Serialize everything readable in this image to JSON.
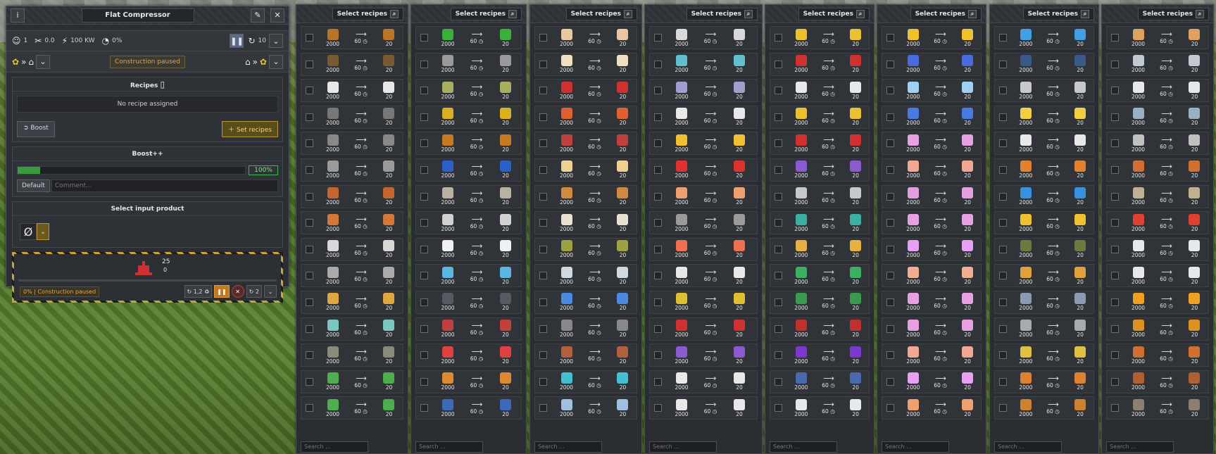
{
  "window": {
    "title": "Flat Compressor"
  },
  "stats": {
    "workers": "1",
    "maintenance": "0.0",
    "power": "100 KW",
    "computing": "0%"
  },
  "control": {
    "pause_count": "10",
    "construction_status": "Construction paused"
  },
  "recipes_section": {
    "heading": "Recipes",
    "empty_text": "No recipe assigned",
    "boost_label": "Boost",
    "set_recipes_label": "Set recipes"
  },
  "boost_section": {
    "heading": "Boost++",
    "percent": "100%",
    "fill_fraction": 0.1,
    "default_label": "Default",
    "comment_placeholder": "Comment..."
  },
  "input_section": {
    "heading": "Select input product",
    "empty_symbol": "Ø"
  },
  "construction": {
    "count_top": "25",
    "count_bottom": "0",
    "status": "0% | Construction paused",
    "priority": "1,2",
    "level": "2"
  },
  "recipe_picker": {
    "header_label": "Select recipes",
    "search_placeholder": "Search ...",
    "input_qty": "2000",
    "duration": "60",
    "output_qty": "20"
  },
  "columns": [
    {
      "colors": [
        "#b9742a",
        "#7a5a30",
        "#e8e8e8",
        "#777777",
        "#888888",
        "#9a9a9a",
        "#c4642e",
        "#d4783a",
        "#d8d8d8",
        "#aaaaaa",
        "#e0a640",
        "#7ac8c0",
        "#8a8a7a",
        "#4cae4c",
        "#4cae4c"
      ]
    },
    {
      "colors": [
        "#3cae3c",
        "#9a9a9a",
        "#a8b060",
        "#d8b020",
        "#c87a20",
        "#2a60c8",
        "#b8b0a0",
        "#d0d0d0",
        "#f0f0f0",
        "#5ab8e0",
        "#555a60",
        "#c04040",
        "#e04040",
        "#e08a30",
        "#3a6ab8"
      ]
    },
    {
      "colors": [
        "#e8c8a0",
        "#f0e0c0",
        "#d03030",
        "#e06030",
        "#c04040",
        "#f0d090",
        "#d08a40",
        "#e8e0d0",
        "#a0a040",
        "#d0d8e0",
        "#4a8ae0",
        "#888888",
        "#b0603a",
        "#40c0d0",
        "#a0c0e0"
      ]
    },
    {
      "colors": [
        "#d8d8d8",
        "#60c0d0",
        "#a0a0d0",
        "#e8e8e8",
        "#f0c030",
        "#e03030",
        "#f0a070",
        "#9a9a9a",
        "#f07050",
        "#e8e8e8",
        "#e0c030",
        "#d03030",
        "#8a5ad0",
        "#e8e8e8",
        "#e8e8e8"
      ]
    },
    {
      "colors": [
        "#e8c030",
        "#d03030",
        "#e8e8e8",
        "#e8c030",
        "#d03030",
        "#8a5ad0",
        "#c8c8c8",
        "#3ab0a0",
        "#e8b040",
        "#3ab060",
        "#3a9a50",
        "#c03030",
        "#7a3ad0",
        "#4a6ab0",
        "#e8e8e8"
      ]
    },
    {
      "colors": [
        "#f0c030",
        "#4a6ae0",
        "#a0d0f0",
        "#4a7ae0",
        "#e8a0e0",
        "#f0a890",
        "#e0a0e0",
        "#e8a0e0",
        "#e8a0f0",
        "#f0b090",
        "#e8a0e0",
        "#e8a0e0",
        "#f0a890",
        "#e8a0f0",
        "#f0a070"
      ]
    },
    {
      "colors": [
        "#40a0e0",
        "#3a5a8a",
        "#c8c8c8",
        "#f0d040",
        "#e8e8e8",
        "#e08030",
        "#3a90e0",
        "#f0c030",
        "#6a7a40",
        "#e0a040",
        "#8a9ab0",
        "#aaaaaa",
        "#e0c040",
        "#e08030",
        "#d08030"
      ]
    },
    {
      "colors": [
        "#e0a060",
        "#c0c8d0",
        "#e8e8e8",
        "#9ab0c0",
        "#c0c0c0",
        "#d07030",
        "#c0b090",
        "#e04030",
        "#e8e8e8",
        "#e8e8e8",
        "#f0a020",
        "#e09020",
        "#d07030",
        "#b06030",
        "#8a8070"
      ]
    }
  ]
}
